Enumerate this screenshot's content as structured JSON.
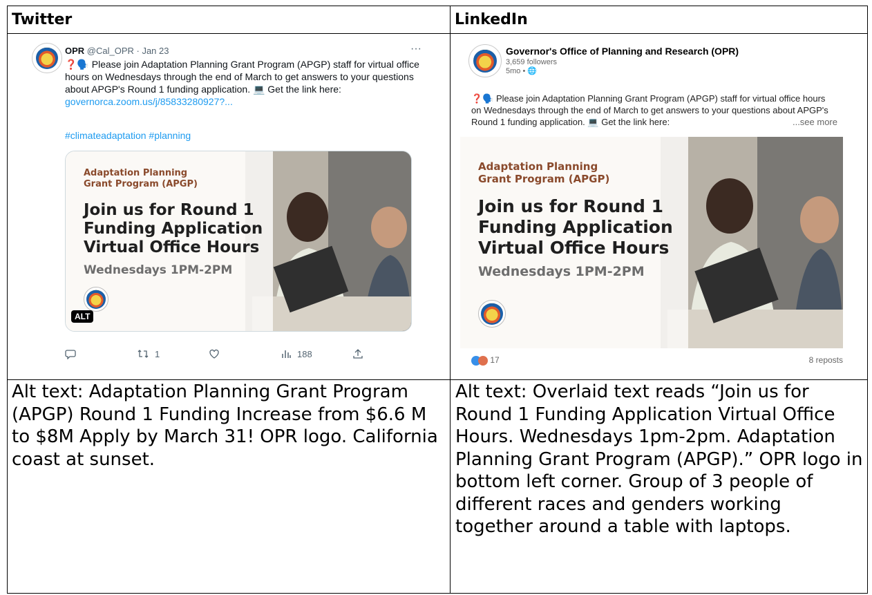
{
  "headers": {
    "twitter": "Twitter",
    "linkedin": "LinkedIn"
  },
  "twitter": {
    "name": "OPR",
    "handle": "@Cal_OPR · Jan 23",
    "more": "···",
    "text_emoji": "❓🗣️",
    "text": " Please join Adaptation Planning Grant Program (APGP) staff for virtual office hours on Wednesdays through the end of March to get answers to your questions about APGP's Round 1 funding application. 💻 Get the link here: ",
    "link": "governorca.zoom.us/j/85833280927?...",
    "hashtags": "#climateadaptation #planning",
    "alt_badge": "ALT",
    "actions": {
      "reply": "",
      "retweets": "1",
      "likes": "",
      "views": "188"
    },
    "icons": {
      "reply": "comment-icon",
      "retweet": "retweet-icon",
      "like": "heart-icon",
      "views": "bar-chart-icon",
      "share": "share-icon"
    }
  },
  "linkedin": {
    "name": "Governor's Office of Planning and Research (OPR)",
    "followers": "3,659 followers",
    "time": "5mo • 🌐",
    "text_emoji": "❓🗣️",
    "text": " Please join Adaptation Planning Grant Program (APGP) staff for virtual office hours on Wednesdays through the end of March to get answers to your questions about APGP's Round 1 funding application. 💻 Get the link here:",
    "see_more": "...see more",
    "reactions": "17",
    "reposts": "8 reposts"
  },
  "media": {
    "subtitle_line1": "Adaptation Planning",
    "subtitle_line2": "Grant Program (APGP)",
    "head1": "Join us for Round 1",
    "head2": "Funding Application",
    "head3": "Virtual Office Hours",
    "when": "Wednesdays 1PM-2PM"
  },
  "alt_texts": {
    "twitter": "Alt text: Adaptation Planning Grant Program (APGP) Round 1 Funding Increase from $6.6 M to $8M Apply by March 31! OPR logo. California coast at sunset.",
    "linkedin": "Alt text: Overlaid text reads “Join us for Round 1 Funding Application Virtual Office Hours. Wednesdays 1pm-2pm. Adaptation Planning Grant Program (APGP).” OPR logo in bottom left corner. Group of 3 people of different races and genders working together around a table with laptops."
  }
}
